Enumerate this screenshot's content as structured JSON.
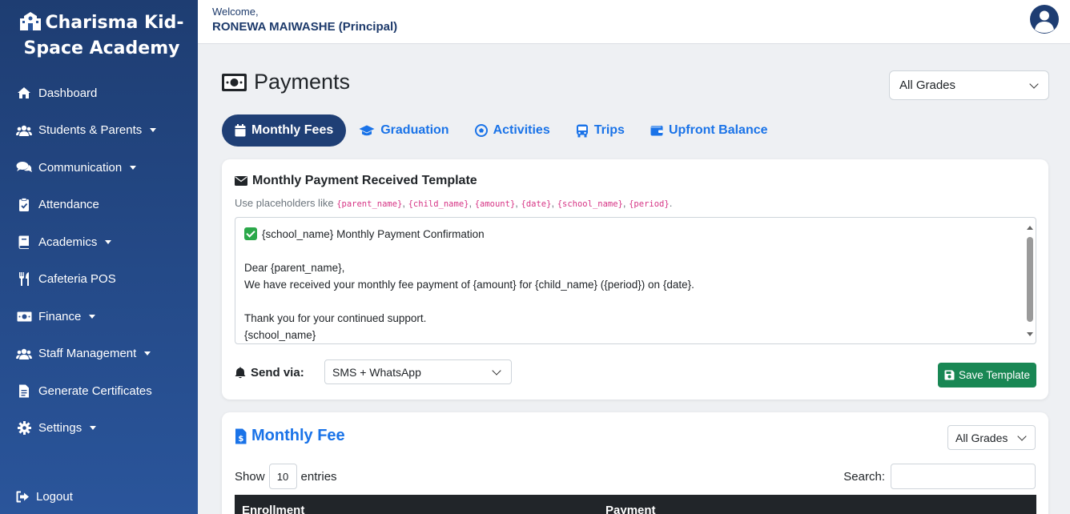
{
  "brand": {
    "name": "Charisma Kid-Space Academy",
    "icon": "school-icon"
  },
  "sidebar": {
    "items": [
      {
        "label": "Dashboard",
        "icon": "home-icon",
        "dropdown": false
      },
      {
        "label": "Students & Parents",
        "icon": "users-icon",
        "dropdown": true
      },
      {
        "label": "Communication",
        "icon": "comments-icon",
        "dropdown": true
      },
      {
        "label": "Attendance",
        "icon": "clipboard-check-icon",
        "dropdown": false
      },
      {
        "label": "Academics",
        "icon": "book-icon",
        "dropdown": true
      },
      {
        "label": "Cafeteria POS",
        "icon": "utensils-icon",
        "dropdown": false
      },
      {
        "label": "Finance",
        "icon": "money-bill-icon",
        "dropdown": true
      },
      {
        "label": "Staff Management",
        "icon": "users-cog-icon",
        "dropdown": true
      },
      {
        "label": "Generate Certificates",
        "icon": "file-icon",
        "dropdown": false
      },
      {
        "label": "Settings",
        "icon": "gear-icon",
        "dropdown": true
      }
    ],
    "logout": "Logout"
  },
  "header": {
    "welcome": "Welcome,",
    "user": "RONEWA MAIWASHE (Principal)"
  },
  "page": {
    "title": "Payments",
    "grade_filter": "All Grades"
  },
  "tabs": [
    {
      "label": "Monthly Fees",
      "icon": "calendar-icon",
      "active": true
    },
    {
      "label": "Graduation",
      "icon": "graduation-cap-icon",
      "active": false
    },
    {
      "label": "Activities",
      "icon": "futbol-icon",
      "active": false
    },
    {
      "label": "Trips",
      "icon": "bus-icon",
      "active": false
    },
    {
      "label": "Upfront Balance",
      "icon": "wallet-icon",
      "active": false
    }
  ],
  "template_card": {
    "title": "Monthly Payment Received Template",
    "hint_prefix": "Use placeholders like ",
    "placeholders": [
      "{parent_name}",
      "{child_name}",
      "{amount}",
      "{date}",
      "{school_name}",
      "{period}"
    ],
    "hint_suffix": ".",
    "message_lines": [
      "{school_name} Monthly Payment Confirmation",
      "",
      "Dear {parent_name},",
      "We have received your monthly fee payment of {amount} for {child_name} ({period}) on {date}.",
      "",
      "Thank you for your continued support.",
      "{school_name}"
    ],
    "send_via_label": "Send via:",
    "send_via_value": "SMS + WhatsApp",
    "save_label": "Save Template"
  },
  "monthly_fee": {
    "title": "Monthly Fee",
    "grade_filter": "All Grades",
    "show_label": "Show",
    "entries_value": "10",
    "entries_label": "entries",
    "search_label": "Search:",
    "columns": [
      "Enrollment",
      "Payment"
    ]
  },
  "colors": {
    "sidebar": "#1e3d72",
    "accent": "#1a73e8",
    "save": "#198754",
    "placeholder": "#d63384"
  }
}
